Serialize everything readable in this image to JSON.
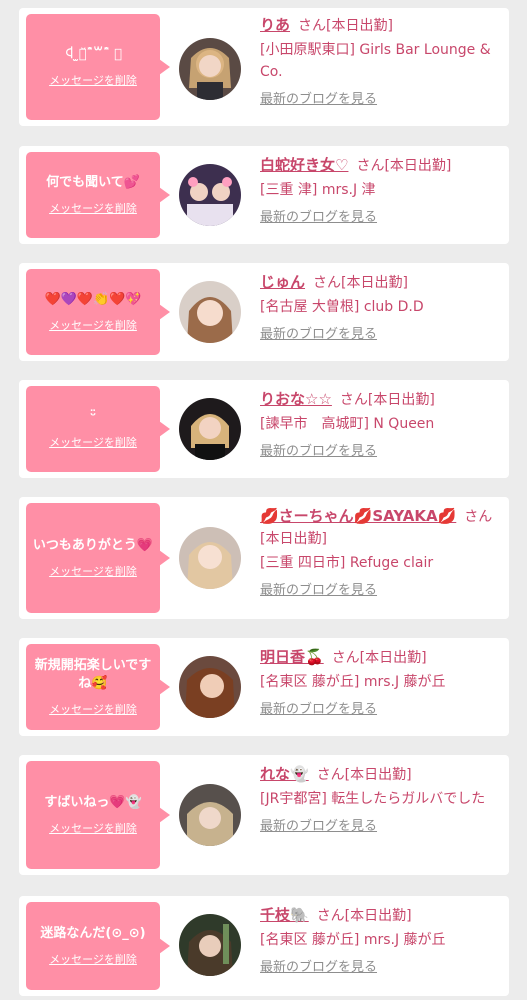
{
  "labels": {
    "delete": "メッセージを削除",
    "san_status": "さん[本日出勤]",
    "blog": "最新のブログを見る"
  },
  "colors": {
    "bubble": "#ff8fa6",
    "accent": "#c8476b",
    "muted": "#8e8e8e",
    "background": "#ececec"
  },
  "entries": [
    {
      "message": "ꒉ ̫ꒉ̆ˆ̆꒳ˆ̆ 𝟑",
      "name": "りあ",
      "shop": "[小田原駅東口] Girls Bar Lounge & Co."
    },
    {
      "message": "何でも聞いて💕",
      "name": "白蛇好き女♡",
      "shop": "[三重 津] mrs.J 津"
    },
    {
      "message": "❤️💜❤️👏❤️💖",
      "name": "じゅん",
      "shop": "[名古屋 大曽根] club D.D"
    },
    {
      "message": "ᵕ̈",
      "name": "りおな☆☆",
      "shop": "[諫早市　高城町] N Queen"
    },
    {
      "message": "いつもありがとう💗",
      "name": "💋さーちゃん💋SAYAKA💋",
      "shop": "[三重 四日市] Refuge clair"
    },
    {
      "message": "新規開拓楽しいですね🥰",
      "name": "明日香🍒",
      "shop": "[名東区 藤が丘] mrs.J 藤が丘"
    },
    {
      "message": "すばいねっ💗👻",
      "name": "れな👻",
      "shop": "[JR宇都宮] 転生したらガルバでした"
    },
    {
      "message": "迷路なんだ(⊙_⊙)",
      "name": "千枝🐘",
      "shop": "[名東区 藤が丘] mrs.J 藤が丘"
    }
  ]
}
